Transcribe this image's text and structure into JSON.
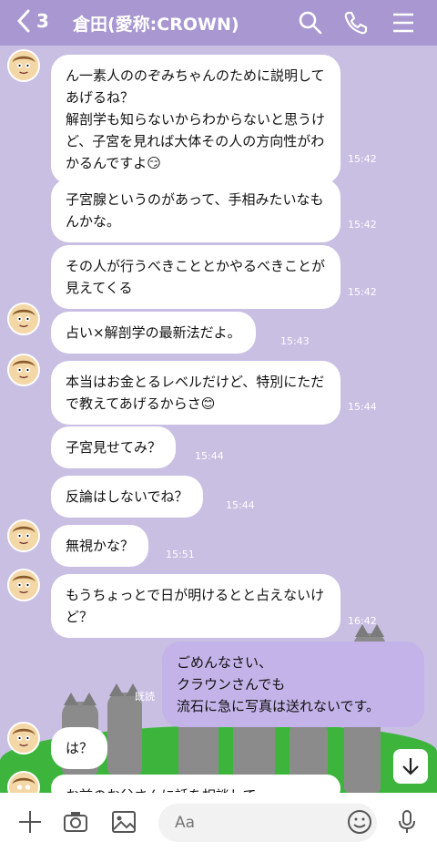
{
  "header": {
    "back_count": "3",
    "title": "倉田(愛称:CROWN)"
  },
  "messages": [
    {
      "text": "ん一素人ののぞみちゃんのために説明してあげるね？\n解剖学も知らないからわからないと思うけど、子宮を見れば大体その人の方向性がわかるんですよ😏",
      "time": "15:42"
    },
    {
      "text": "子宮腺というのがあって、手相みたいなもんかな。",
      "time": "15:42"
    },
    {
      "text": "その人が行うべきこととかやるべきことが見えてくる",
      "time": "15:42"
    },
    {
      "text": "占い×解剖学の最新法だよ。",
      "time": "15:43"
    },
    {
      "text": "本当はお金とるレベルだけど、特別にただで教えてあげるからさ😊",
      "time": "15:44"
    },
    {
      "text": "子宮見せてみ？",
      "time": "15:44"
    },
    {
      "text": "反論はしないでね？",
      "time": "15:44"
    },
    {
      "text": "無視かな？",
      "time": "15:51"
    },
    {
      "text": "もうちょっとで日が明けるとと占えないけど？",
      "time": "16:42"
    },
    {
      "text": "ごめんなさい、\nクラウンさんでも\n流石に急に写真は送れないです。",
      "time": ""
    },
    {
      "text": "は？",
      "time": ""
    },
    {
      "text": "お前のお父さんに話を相談して",
      "time": ""
    }
  ],
  "read_label": "既読",
  "composer": {
    "placeholder": "Aa"
  },
  "colors": {
    "header": "#a897d0",
    "background": "#c9bfe3",
    "my_bubble": "#c4b3e8",
    "grass": "#3db53d"
  },
  "icons": [
    "chevron-left-icon",
    "search-icon",
    "phone-icon",
    "menu-icon",
    "plus-icon",
    "camera-icon",
    "image-icon",
    "emoji-icon",
    "mic-icon",
    "arrow-down-icon"
  ]
}
